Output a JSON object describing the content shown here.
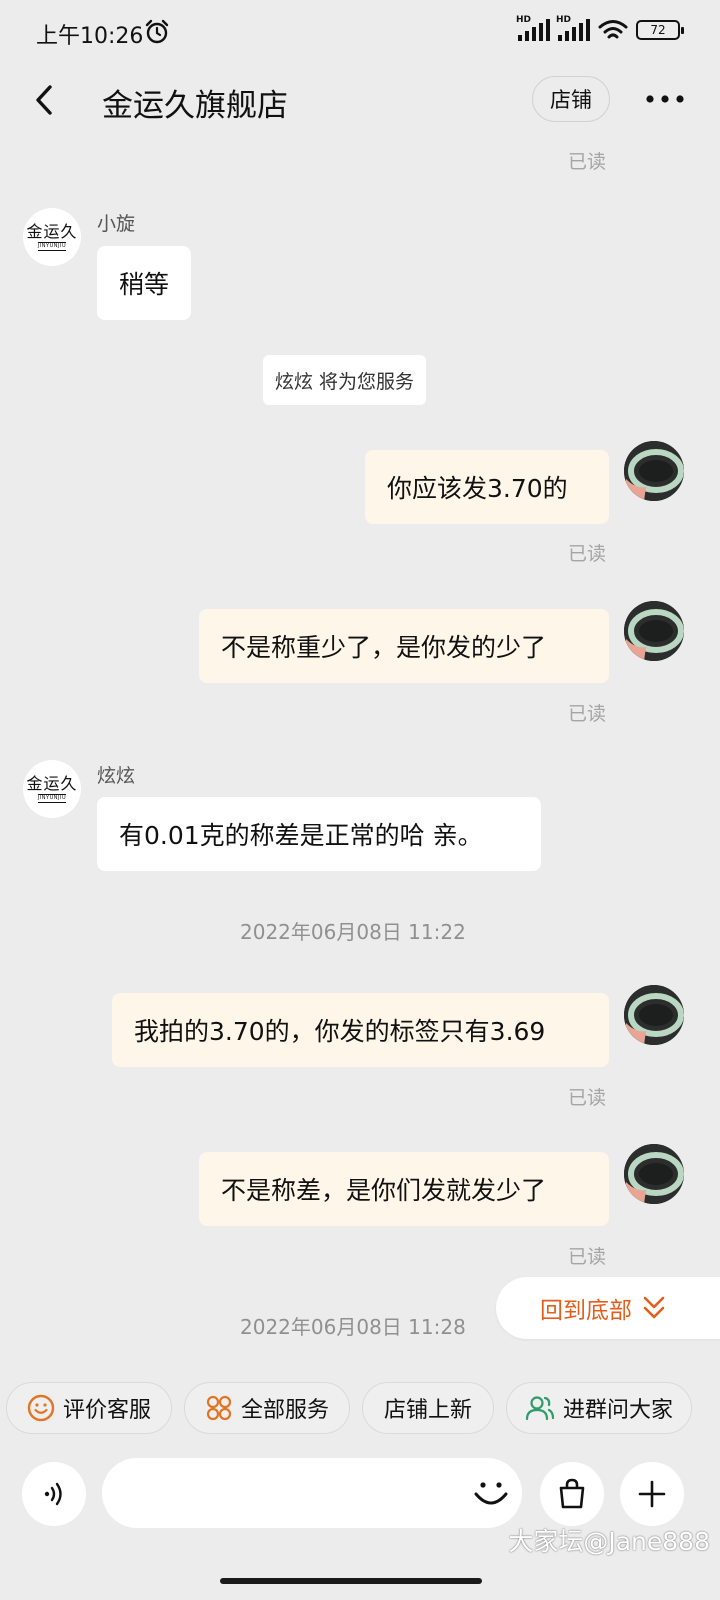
{
  "status_bar": {
    "time": "上午10:26",
    "hd1": "HD",
    "hd2": "HD",
    "battery": "72"
  },
  "header": {
    "title": "金运久旗舰店",
    "shop_button": "店铺"
  },
  "avatar_shop": {
    "brand": "金运久",
    "brand_sub": "JINYUNJIU"
  },
  "messages": {
    "read_label": "已读",
    "m1": {
      "sender": "小旋",
      "text": "稍等"
    },
    "system": "炫炫 将为您服务",
    "m2": {
      "text": "你应该发3.70的"
    },
    "m3": {
      "text": "不是称重少了，是你发的少了"
    },
    "m4": {
      "sender": "炫炫",
      "text": "有0.01克的称差是正常的哈 亲。"
    },
    "ts1": "2022年06月08日  11:22",
    "m5": {
      "text": "我拍的3.70的，你发的标签只有3.69"
    },
    "m6": {
      "text": "不是称差，是你们发就发少了"
    },
    "ts2": "2022年06月08日  11:28"
  },
  "back_to_bottom": "回到底部",
  "quick_actions": [
    {
      "label": "评价客服",
      "icon": "smile-icon"
    },
    {
      "label": "全部服务",
      "icon": "grid-icon"
    },
    {
      "label": "店铺上新"
    },
    {
      "label": "进群问大家",
      "icon": "group-icon"
    }
  ],
  "input": {
    "value": "",
    "placeholder": ""
  },
  "watermark": "大家坛@Jane888",
  "colors": {
    "accent": "#e25f1b",
    "bubble_out": "#fdf6e9",
    "bubble_in": "#ffffff",
    "background": "#ececec"
  }
}
